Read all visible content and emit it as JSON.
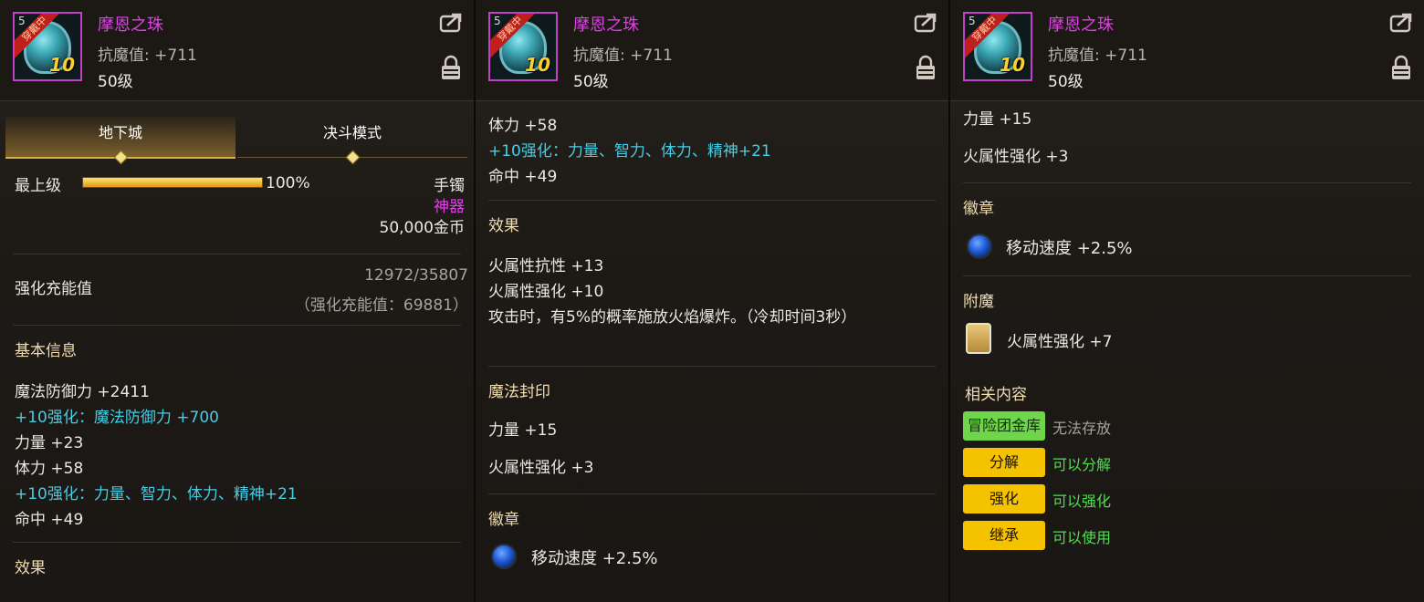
{
  "item": {
    "name": "摩恩之珠",
    "stat": "抗魔值: +711",
    "level": "50级",
    "icon_badge": "穿戴中",
    "icon_number": "5",
    "icon_level": "10"
  },
  "p1": {
    "tabs": [
      "地下城",
      "决斗模式"
    ],
    "rank_label": "最上级",
    "rank_percent_text": "100%",
    "rank_fill": 1.0,
    "slot": "手镯",
    "rarity": "神器",
    "price": "50,000金币",
    "charge_label": "强化充能值",
    "charge_value": "12972/35807",
    "charge_sub": "（强化充能值：69881）",
    "basic_title": "基本信息",
    "basic_lines": [
      {
        "text": "魔法防御力 +2411",
        "style": "normal"
      },
      {
        "text": "+10强化：魔法防御力 +700",
        "style": "cyan"
      },
      {
        "text": "力量 +23",
        "style": "normal"
      },
      {
        "text": "体力 +58",
        "style": "normal"
      },
      {
        "text": "+10强化：力量、智力、体力、精神+21",
        "style": "cyan"
      },
      {
        "text": "命中 +49",
        "style": "normal"
      }
    ],
    "effect_title": "效果"
  },
  "p2": {
    "lines_top": [
      {
        "text": "体力 +58",
        "style": "normal"
      },
      {
        "text": "+10强化：力量、智力、体力、精神+21",
        "style": "cyan"
      },
      {
        "text": "命中 +49",
        "style": "normal"
      }
    ],
    "effect_title": "效果",
    "effect_lines": [
      "火属性抗性 +13",
      "火属性强化 +10",
      "攻击时，有5%的概率施放火焰爆炸。（冷却时间3秒）"
    ],
    "seal_title": "魔法封印",
    "seal_lines": [
      "力量 +15",
      "火属性强化 +3"
    ],
    "emblem_title": "徽章",
    "emblem_text": "移动速度 +2.5%"
  },
  "p3": {
    "seal_lines": [
      "力量 +15",
      "火属性强化 +3"
    ],
    "emblem_title": "徽章",
    "emblem_text": "移动速度 +2.5%",
    "enchant_title": "附魔",
    "enchant_text": "火属性强化 +7",
    "related_title": "相关内容",
    "related": [
      {
        "button": "冒险团金库",
        "status": "无法存放",
        "button_color": "green",
        "status_color": "grey"
      },
      {
        "button": "分解",
        "status": "可以分解",
        "button_color": "yellow",
        "status_color": "green"
      },
      {
        "button": "强化",
        "status": "可以强化",
        "button_color": "yellow",
        "status_color": "green"
      },
      {
        "button": "继承",
        "status": "可以使用",
        "button_color": "yellow",
        "status_color": "green"
      }
    ]
  },
  "colors": {
    "name": "#e040e8",
    "cyan": "#46cde6",
    "green_text": "#4fe04f",
    "button_yellow": "#f5c200",
    "button_green": "#6fd64a"
  }
}
